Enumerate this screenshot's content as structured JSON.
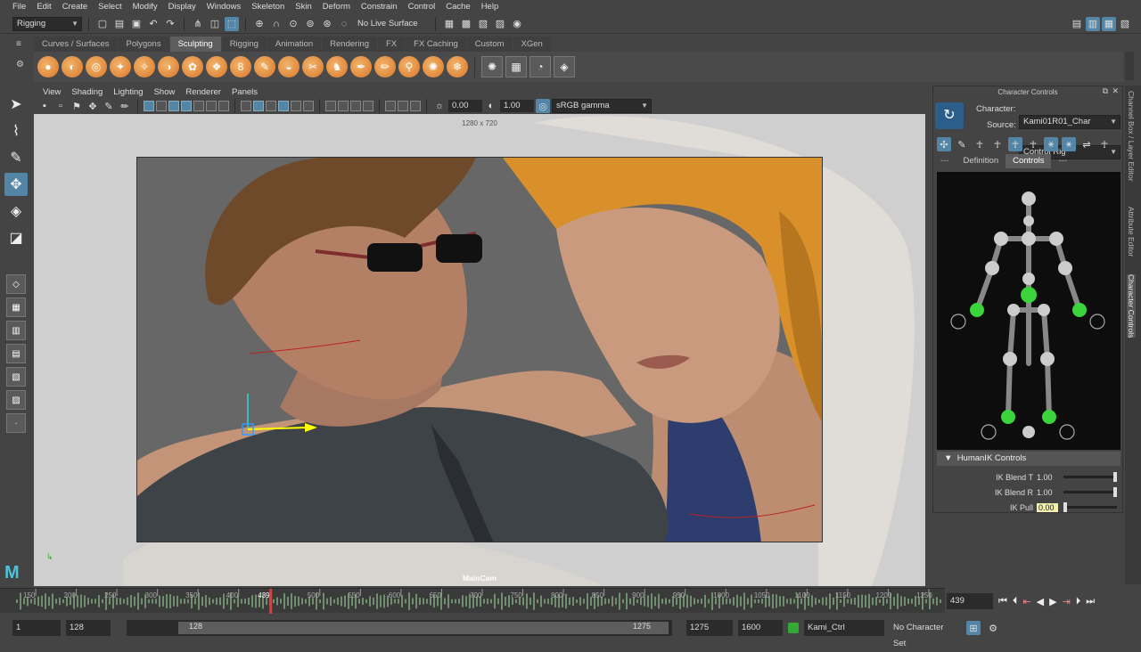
{
  "menubar": [
    "File",
    "Edit",
    "Create",
    "Select",
    "Modify",
    "Display",
    "Windows",
    "Skeleton",
    "Skin",
    "Deform",
    "Constrain",
    "Control",
    "Cache",
    "Help"
  ],
  "status": {
    "menuset": "Rigging",
    "live_surface": "No Live Surface"
  },
  "shelf_tabs": [
    "Curves / Surfaces",
    "Polygons",
    "Sculpting",
    "Rigging",
    "Animation",
    "Rendering",
    "FX",
    "FX Caching",
    "Custom",
    "XGen"
  ],
  "shelf_selected": "Sculpting",
  "viewport": {
    "menu": [
      "View",
      "Shading",
      "Lighting",
      "Show",
      "Renderer",
      "Panels"
    ],
    "exposure": "0.00",
    "gamma": "1.00",
    "colorspace": "sRGB gamma",
    "resolution": "1280 x 720",
    "camera": "MainCam"
  },
  "character_controls": {
    "title": "Character Controls",
    "character_label": "Character:",
    "character": "Kami01R01_Char",
    "source_label": "Source:",
    "source": "Control Rig",
    "tabs": [
      "Definition",
      "Controls"
    ],
    "tab_selected": "Controls",
    "section": "HumanIK Controls",
    "params": [
      {
        "label": "IK Blend T",
        "value": "1.00",
        "level": 1.0
      },
      {
        "label": "IK Blend R",
        "value": "1.00",
        "level": 1.0
      },
      {
        "label": "IK Pull",
        "value": "0.00",
        "level": 0.0
      }
    ]
  },
  "side_tabs": [
    "Channel Box / Layer Editor",
    "Attribute Editor",
    "Character Controls"
  ],
  "timeline": {
    "ticks": [
      "150",
      "200",
      "250",
      "300",
      "350",
      "400",
      "439",
      "500",
      "550",
      "600",
      "650",
      "700",
      "750",
      "800",
      "850",
      "900",
      "950",
      "1000",
      "1050",
      "1100",
      "1150",
      "1200",
      "1250"
    ],
    "current_frame": "439"
  },
  "range": {
    "start": "1",
    "range_start": "128",
    "slider_start": "128",
    "slider_end": "1275",
    "range_end": "1275",
    "end": "1600",
    "char": "Kami_Ctrl",
    "char_set": "No Character Set"
  }
}
